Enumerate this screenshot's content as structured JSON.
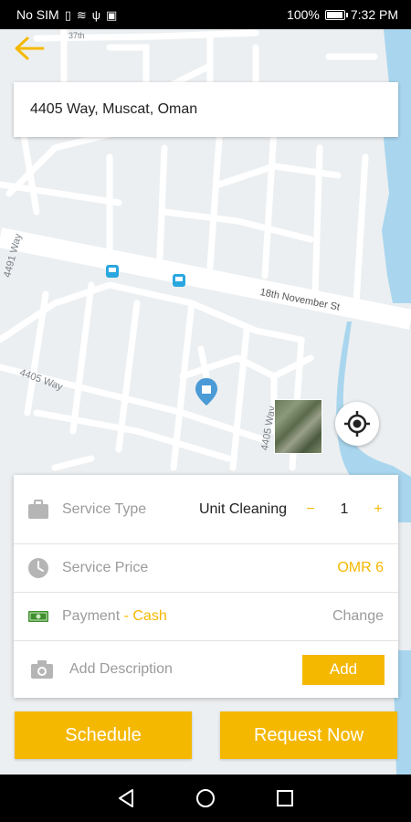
{
  "status_bar": {
    "carrier": "No SIM",
    "battery": "100%",
    "battery_level": 1.0,
    "time": "7:32 PM"
  },
  "map": {
    "street_labels": [
      "37th",
      "4491 Way",
      "4405 Way",
      "18th November St",
      "4405 Way"
    ]
  },
  "address": {
    "value": "4405 Way, Muscat, Oman"
  },
  "service": {
    "type_label": "Service Type",
    "type_value": "Unit Cleaning",
    "qty_minus": "−",
    "quantity": "1",
    "qty_plus": "+",
    "price_label": "Service Price",
    "price_value": "OMR 6",
    "payment_label": "Payment",
    "payment_sep": " - ",
    "payment_method": "Cash",
    "change_label": "Change",
    "description_placeholder": "Add Description",
    "add_label": "Add"
  },
  "actions": {
    "schedule": "Schedule",
    "request_now": "Request Now"
  },
  "colors": {
    "accent": "#f5b800",
    "map_bg": "#eceff1",
    "road": "#ffffff",
    "water": "#a9d6ee"
  },
  "icons": [
    "back-arrow-icon",
    "briefcase-icon",
    "clock-icon",
    "cash-icon",
    "camera-icon",
    "my-location-icon",
    "bus-stop-icon",
    "place-icon"
  ]
}
